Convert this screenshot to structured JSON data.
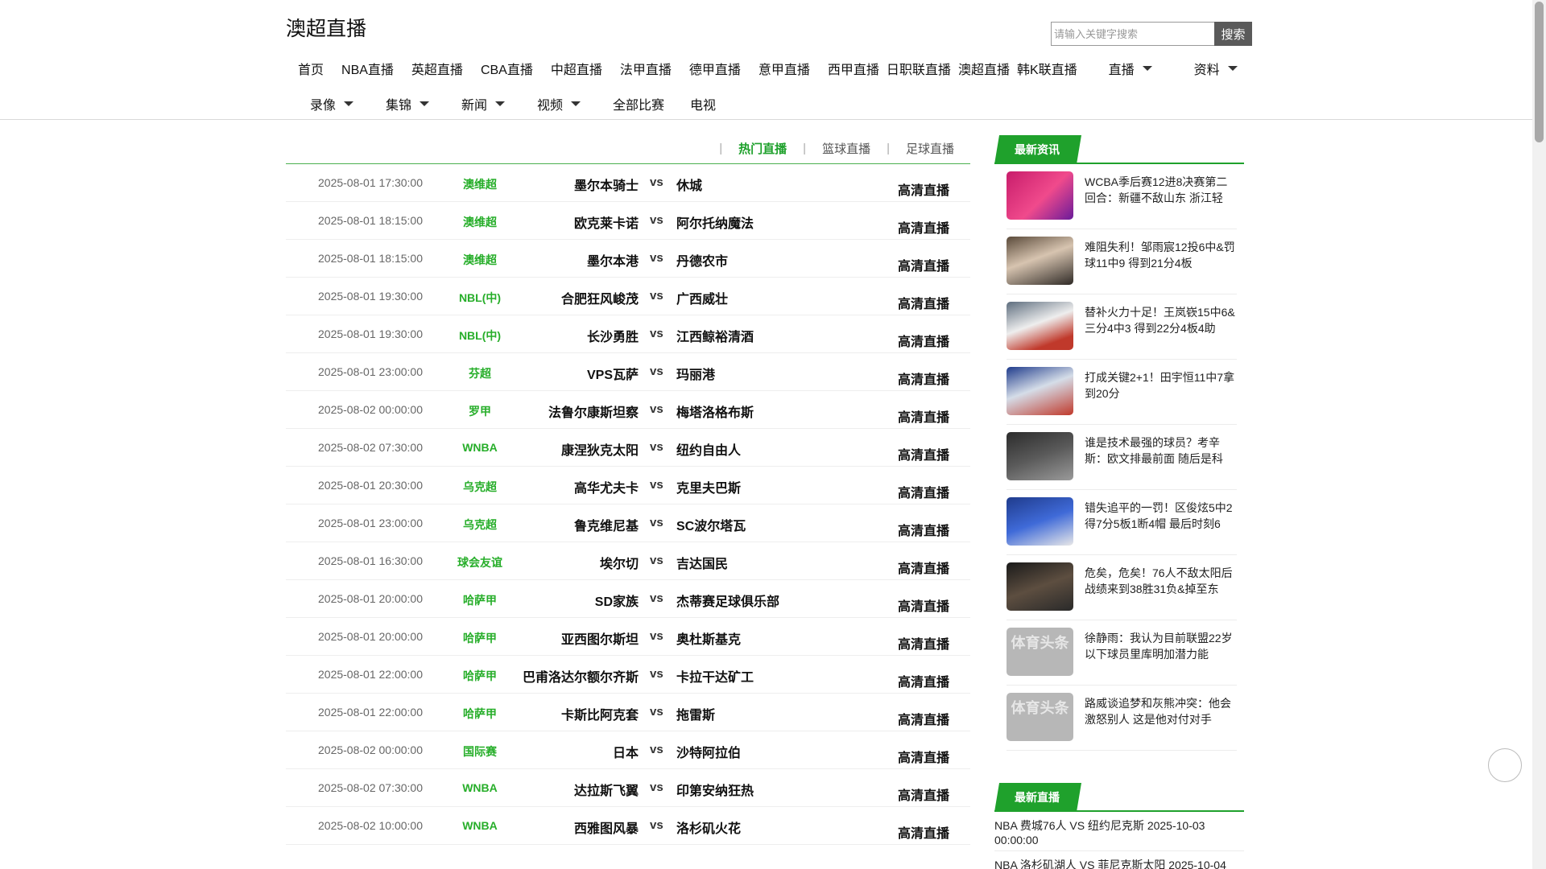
{
  "header": {
    "title": "澳超直播",
    "search": {
      "placeholder": "请输入关键字搜索",
      "value": "",
      "button_label": "搜索"
    },
    "nav_row_1": [
      {
        "label": "首页"
      },
      {
        "label": "NBA直播"
      },
      {
        "label": "英超直播"
      },
      {
        "label": "CBA直播"
      },
      {
        "label": "中超直播"
      },
      {
        "label": "法甲直播"
      },
      {
        "label": "德甲直播"
      },
      {
        "label": "意甲直播"
      },
      {
        "label": "西甲直播"
      },
      {
        "label": "日职联直播"
      },
      {
        "label": "澳超直播"
      },
      {
        "label": "韩K联直播"
      }
    ],
    "nav_row_1_dropdowns": [
      {
        "label": "直播"
      },
      {
        "label": "资料"
      }
    ],
    "nav_row_2": [
      {
        "label": "录像",
        "dropdown": true
      },
      {
        "label": "集锦",
        "dropdown": true
      },
      {
        "label": "新闻",
        "dropdown": true
      },
      {
        "label": "视频",
        "dropdown": true
      },
      {
        "label": "全部比赛",
        "dropdown": false
      },
      {
        "label": "电视",
        "dropdown": false
      }
    ]
  },
  "match_tabs": [
    {
      "label": "热门直播",
      "active": true
    },
    {
      "label": "篮球直播",
      "active": false
    },
    {
      "label": "足球直播",
      "active": false
    }
  ],
  "matches": [
    {
      "time": "2025-08-01 17:30:00",
      "league": "澳维超",
      "home": "墨尔本骑士",
      "away": "休城",
      "live": "高清直播"
    },
    {
      "time": "2025-08-01 18:15:00",
      "league": "澳维超",
      "home": "欧克莱卡诺",
      "away": "阿尔托纳魔法",
      "live": "高清直播"
    },
    {
      "time": "2025-08-01 18:15:00",
      "league": "澳维超",
      "home": "墨尔本港",
      "away": "丹德农市",
      "live": "高清直播"
    },
    {
      "time": "2025-08-01 19:30:00",
      "league": "NBL(中)",
      "home": "合肥狂风峻茂",
      "away": "广西威壮",
      "live": "高清直播"
    },
    {
      "time": "2025-08-01 19:30:00",
      "league": "NBL(中)",
      "home": "长沙勇胜",
      "away": "江西鲸裕清酒",
      "live": "高清直播"
    },
    {
      "time": "2025-08-01 23:00:00",
      "league": "芬超",
      "home": "VPS瓦萨",
      "away": "玛丽港",
      "live": "高清直播"
    },
    {
      "time": "2025-08-02 00:00:00",
      "league": "罗甲",
      "home": "法鲁尔康斯坦察",
      "away": "梅塔洛格布斯",
      "live": "高清直播"
    },
    {
      "time": "2025-08-02 07:30:00",
      "league": "WNBA",
      "home": "康涅狄克太阳",
      "away": "纽约自由人",
      "live": "高清直播"
    },
    {
      "time": "2025-08-01 20:30:00",
      "league": "乌克超",
      "home": "高华尤夫卡",
      "away": "克里夫巴斯",
      "live": "高清直播"
    },
    {
      "time": "2025-08-01 23:00:00",
      "league": "乌克超",
      "home": "鲁克维尼基",
      "away": "SC波尔塔瓦",
      "live": "高清直播"
    },
    {
      "time": "2025-08-01 16:30:00",
      "league": "球会友谊",
      "home": "埃尔切",
      "away": "吉达国民",
      "live": "高清直播"
    },
    {
      "time": "2025-08-01 20:00:00",
      "league": "哈萨甲",
      "home": "SD家族",
      "away": "杰蒂赛足球俱乐部",
      "live": "高清直播"
    },
    {
      "time": "2025-08-01 20:00:00",
      "league": "哈萨甲",
      "home": "亚西图尔斯坦",
      "away": "奥杜斯基克",
      "live": "高清直播"
    },
    {
      "time": "2025-08-01 22:00:00",
      "league": "哈萨甲",
      "home": "巴甫洛达尔额尔齐斯",
      "away": "卡拉干达矿工",
      "live": "高清直播"
    },
    {
      "time": "2025-08-01 22:00:00",
      "league": "哈萨甲",
      "home": "卡斯比阿克套",
      "away": "拖雷斯",
      "live": "高清直播"
    },
    {
      "time": "2025-08-02 00:00:00",
      "league": "国际赛",
      "home": "日本",
      "away": "沙特阿拉伯",
      "live": "高清直播"
    },
    {
      "time": "2025-08-02 07:30:00",
      "league": "WNBA",
      "home": "达拉斯飞翼",
      "away": "印第安纳狂热",
      "live": "高清直播"
    },
    {
      "time": "2025-08-02 10:00:00",
      "league": "WNBA",
      "home": "西雅图风暴",
      "away": "洛杉矶火花",
      "live": "高清直播"
    }
  ],
  "sidebar": {
    "news_heading": "最新资讯",
    "news": [
      {
        "title": "WCBA季后赛12进8决赛第二回合：新疆不敌山东 浙江轻",
        "thumb": "poster-image"
      },
      {
        "title": "难阻失利！邹雨宸12投6中&罚球11中9 得到21分4板",
        "thumb": "player-photo"
      },
      {
        "title": "替补火力十足！王岚嵚15中6&三分4中3 得到22分4板4助",
        "thumb": "player-photo"
      },
      {
        "title": "打成关键2+1！田宇恒11中7拿到20分",
        "thumb": "player-photo"
      },
      {
        "title": "谁是技术最强的球员？考辛斯：欧文排最前面 随后是科",
        "thumb": "player-photo"
      },
      {
        "title": "错失追平的一罚！区俊炫5中2得7分5板1断4帽 最后时刻6",
        "thumb": "player-photo"
      },
      {
        "title": "危矣，危矣！76人不敌太阳后战绩来到38胜31负&掉至东",
        "thumb": "coach-photo"
      },
      {
        "title": "徐静雨：我认为目前联盟22岁以下球员里库明加潜力能",
        "thumb": "placeholder-logo",
        "thumb_text": "体育头条"
      },
      {
        "title": "路威谈追梦和灰熊冲突：他会激怒别人 这是他对付对手",
        "thumb": "placeholder-logo",
        "thumb_text": "体育头条"
      }
    ],
    "latest_heading": "最新直播",
    "latest_live": [
      {
        "text": "NBA 费城76人 VS 纽约尼克斯 2025-10-03 00:00:00"
      },
      {
        "text": "NBA 洛杉矶湖人 VS 菲尼克斯太阳 2025-10-04"
      }
    ]
  }
}
